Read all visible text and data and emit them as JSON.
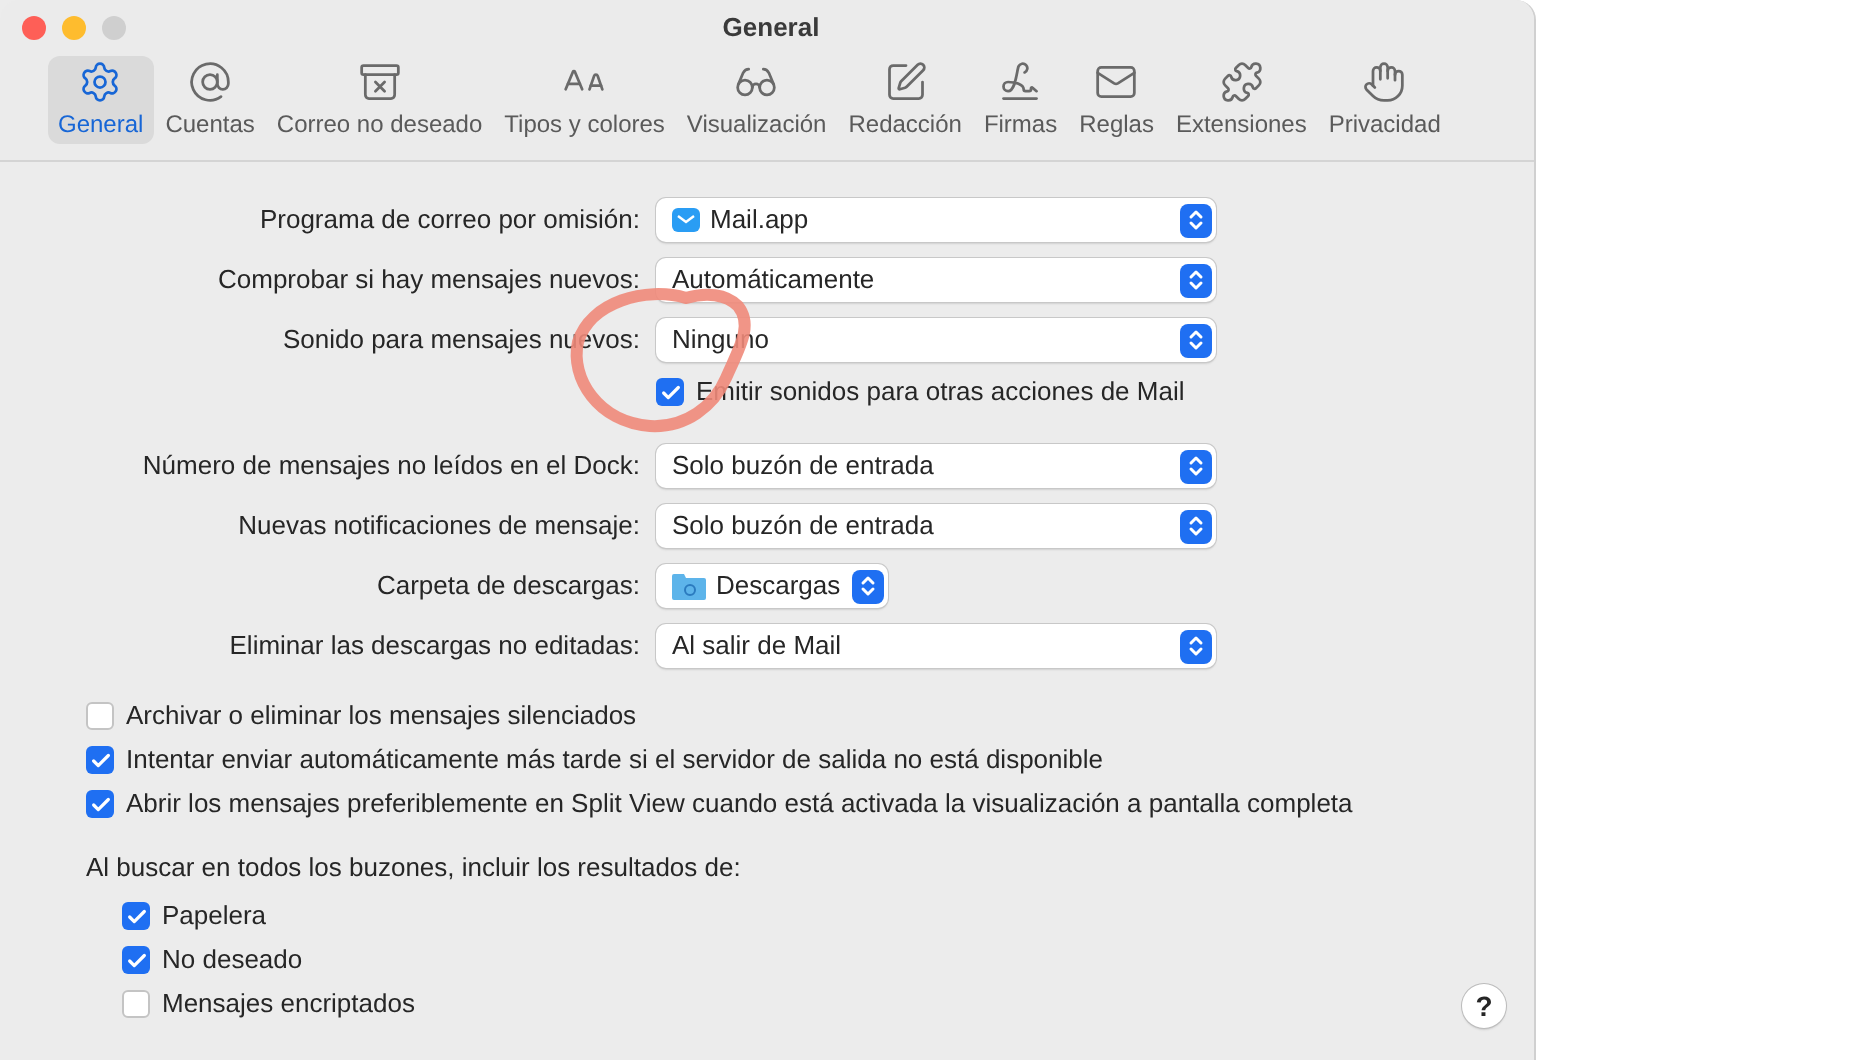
{
  "window": {
    "title": "General"
  },
  "toolbar": [
    {
      "label": "General",
      "selected": true
    },
    {
      "label": "Cuentas",
      "selected": false
    },
    {
      "label": "Correo no deseado",
      "selected": false
    },
    {
      "label": "Tipos y colores",
      "selected": false
    },
    {
      "label": "Visualización",
      "selected": false
    },
    {
      "label": "Redacción",
      "selected": false
    },
    {
      "label": "Firmas",
      "selected": false
    },
    {
      "label": "Reglas",
      "selected": false
    },
    {
      "label": "Extensiones",
      "selected": false
    },
    {
      "label": "Privacidad",
      "selected": false
    }
  ],
  "settings": [
    {
      "kind": "app-popup",
      "label": "Programa de correo por omisión:",
      "value": "Mail.app"
    },
    {
      "kind": "popup",
      "label": "Comprobar si hay mensajes nuevos:",
      "value": "Automáticamente"
    },
    {
      "kind": "popup",
      "label": "Sonido para mensajes nuevos:",
      "value": "Ninguno"
    },
    {
      "kind": "checkbox",
      "label": "Emitir sonidos para otras acciones de Mail",
      "checked": true
    },
    {
      "kind": "popup",
      "label": "Número de mensajes no leídos en el Dock:",
      "value": "Solo buzón de entrada"
    },
    {
      "kind": "popup",
      "label": "Nuevas notificaciones de mensaje:",
      "value": "Solo buzón de entrada"
    },
    {
      "kind": "folder-popup",
      "label": "Carpeta de descargas:",
      "value": "Descargas"
    },
    {
      "kind": "popup",
      "label": "Eliminar las descargas no editadas:",
      "value": "Al salir de Mail"
    }
  ],
  "options": [
    {
      "label": "Archivar o eliminar los mensajes silenciados",
      "checked": false
    },
    {
      "label": "Intentar enviar automáticamente más tarde si el servidor de salida no está disponible",
      "checked": true
    },
    {
      "label": "Abrir los mensajes preferiblemente en Split View cuando está activada la visualización a pantalla completa",
      "checked": true
    }
  ],
  "search_scope": {
    "heading": "Al buscar en todos los buzones, incluir los resultados de:",
    "items": [
      {
        "label": "Papelera",
        "checked": true
      },
      {
        "label": "No deseado",
        "checked": true
      },
      {
        "label": "Mensajes encriptados",
        "checked": false
      }
    ]
  },
  "help_button": "?"
}
